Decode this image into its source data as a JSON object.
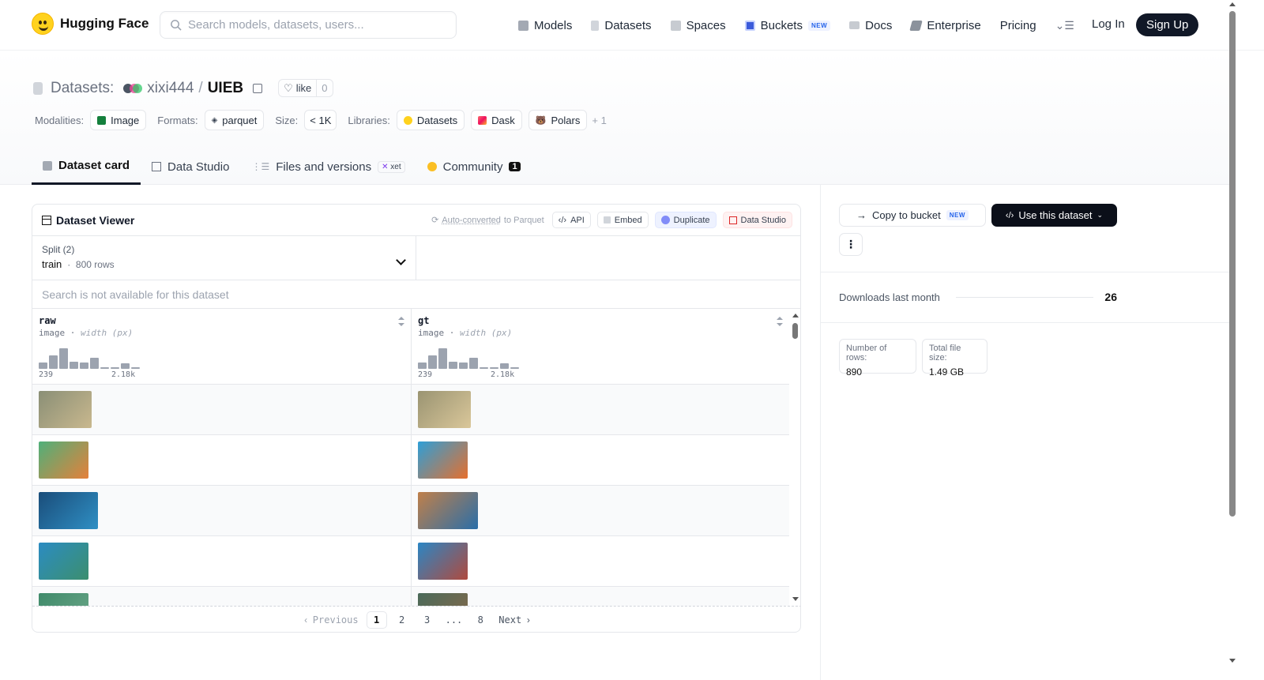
{
  "brand": {
    "name": "Hugging Face"
  },
  "search": {
    "placeholder": "Search models, datasets, users..."
  },
  "nav": {
    "items": [
      {
        "label": "Models",
        "icon": "cube-icon",
        "color": "#9ca3af"
      },
      {
        "label": "Datasets",
        "icon": "database-icon",
        "color": "#d1d5db"
      },
      {
        "label": "Spaces",
        "icon": "grid-icon",
        "color": "#c7cbd1"
      },
      {
        "label": "Buckets",
        "icon": "bucket-icon",
        "color": "#3b5bdb",
        "badge": "NEW"
      },
      {
        "label": "Docs",
        "icon": "book-icon",
        "color": "#c7cbd1"
      },
      {
        "label": "Enterprise",
        "icon": "briefcase-icon",
        "color": "#6b7280"
      },
      {
        "label": "Pricing"
      }
    ],
    "more_icon": "menu-icon",
    "login": "Log In",
    "signup": "Sign Up"
  },
  "dataset": {
    "prefix": "Datasets:",
    "owner": "xixi444",
    "separator": "/",
    "name": "UIEB",
    "like_label": "like",
    "like_count": "0"
  },
  "meta": {
    "modalities_label": "Modalities:",
    "modality": "Image",
    "formats_label": "Formats:",
    "format": "parquet",
    "size_label": "Size:",
    "size": "< 1K",
    "libraries_label": "Libraries:",
    "libraries": [
      "Datasets",
      "Dask",
      "Polars"
    ],
    "libraries_more": "+ 1"
  },
  "tabs": [
    {
      "label": "Dataset card",
      "active": true
    },
    {
      "label": "Data Studio"
    },
    {
      "label": "Files and versions",
      "badge": "xet"
    },
    {
      "label": "Community",
      "count": "1"
    }
  ],
  "viewer": {
    "title": "Dataset Viewer",
    "auto_converted_link": "Auto-converted",
    "auto_converted_suffix": "to Parquet",
    "buttons": {
      "api": "API",
      "embed": "Embed",
      "duplicate": "Duplicate",
      "data_studio": "Data Studio"
    },
    "split_label": "Split (2)",
    "split_value": "train",
    "split_rows": "800 rows",
    "search_notice": "Search is not available for this dataset",
    "columns": [
      {
        "name": "raw",
        "type": "image",
        "subtype": "width (px)",
        "min": "239",
        "max": "2.18k",
        "hist": [
          0.3,
          0.65,
          1.0,
          0.35,
          0.3,
          0.55,
          0.05,
          0.05,
          0.28,
          0.05
        ]
      },
      {
        "name": "gt",
        "type": "image",
        "subtype": "width (px)",
        "min": "239",
        "max": "2.18k",
        "hist": [
          0.3,
          0.65,
          1.0,
          0.35,
          0.3,
          0.55,
          0.05,
          0.05,
          0.28,
          0.05
        ]
      }
    ],
    "rows": [
      {
        "raw_colors": [
          "#8a8f76",
          "#c9b88e"
        ],
        "gt_colors": [
          "#9a9472",
          "#dac79a"
        ]
      },
      {
        "raw_colors": [
          "#4fb07a",
          "#e5803a"
        ],
        "gt_colors": [
          "#2d9fd8",
          "#e66f2d"
        ]
      },
      {
        "raw_colors": [
          "#1a4d7a",
          "#2f8fc4"
        ],
        "gt_colors": [
          "#c0804a",
          "#2a6ea8"
        ]
      },
      {
        "raw_colors": [
          "#2b8cc2",
          "#3c8f6e"
        ],
        "gt_colors": [
          "#2b86c4",
          "#b04a3e"
        ]
      },
      {
        "raw_colors": [
          "#3f8a6a",
          "#6ea88a"
        ],
        "gt_colors": [
          "#4a6a5a",
          "#8a6a4a"
        ]
      }
    ],
    "pagination": {
      "previous": "Previous",
      "pages": [
        "1",
        "2",
        "3",
        "...",
        "8"
      ],
      "current": "1",
      "next": "Next"
    }
  },
  "sidebar": {
    "copy_bucket": "Copy to bucket",
    "copy_bucket_badge": "NEW",
    "use_dataset": "Use this dataset",
    "downloads_label": "Downloads last month",
    "downloads_value": "26",
    "num_rows_label": "Number of rows:",
    "num_rows_value": "890",
    "file_size_label": "Total file size:",
    "file_size_value": "1.49 GB"
  }
}
